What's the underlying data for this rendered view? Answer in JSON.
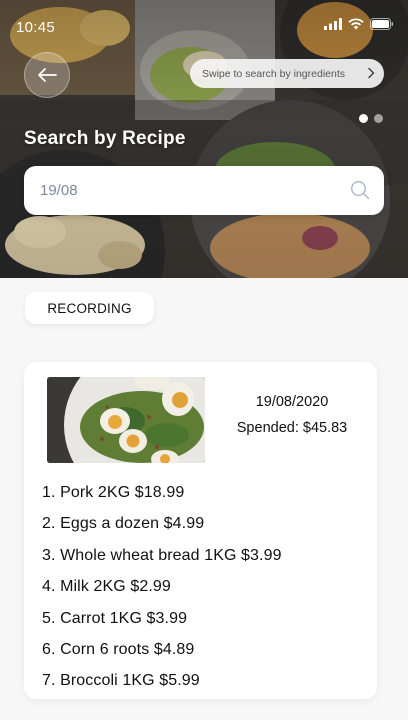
{
  "status_bar": {
    "time": "10:45"
  },
  "hero": {
    "swipe_hint": "Swipe to search by ingredients",
    "title": "Search by Recipe",
    "carousel": {
      "total": 2,
      "active": 0
    }
  },
  "search": {
    "value": "19/08"
  },
  "section": {
    "label": "RECORDING"
  },
  "record": {
    "date": "19/08/2020",
    "spent": "Spended: $45.83",
    "items": [
      "1. Pork 2KG $18.99",
      "2. Eggs a dozen $4.99",
      "3. Whole wheat bread 1KG $3.99",
      "4. Milk 2KG $2.99",
      "5. Carrot 1KG $3.99",
      "6. Corn 6 roots $4.89",
      "7. Broccoli 1KG $5.99"
    ]
  },
  "icons": [
    "signal-icon",
    "wifi-icon",
    "battery-icon",
    "back-arrow-icon",
    "chevron-right-icon",
    "search-icon"
  ]
}
